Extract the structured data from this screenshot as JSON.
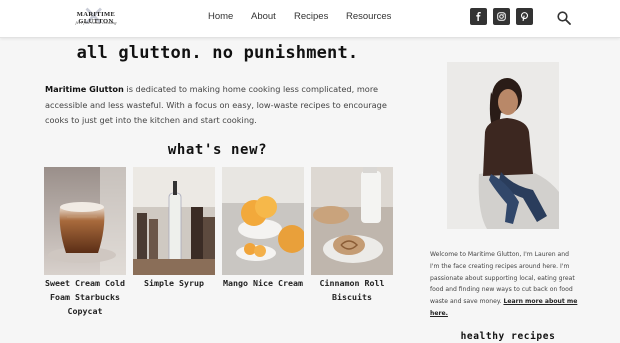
{
  "header": {
    "logo": {
      "name": "MARITIME GLUTTON",
      "tagline": "feel-free home cooking"
    },
    "nav": [
      "Home",
      "About",
      "Recipes",
      "Resources"
    ],
    "social_icons": [
      "facebook-icon",
      "instagram-icon",
      "pinterest-icon"
    ],
    "search_icon": "search-icon"
  },
  "main": {
    "headline": "all glutton. no punishment.",
    "intro": {
      "brand": "Maritime Glutton",
      "text": " is dedicated to making home cooking less complicated, more accessible and less wasteful. With a focus on easy, low-waste recipes to encourage cooks to just get into the kitchen and start cooking."
    },
    "whats_new": "what's new?",
    "posts": [
      {
        "title": "Sweet Cream Cold Foam Starbucks Copycat"
      },
      {
        "title": "Simple Syrup"
      },
      {
        "title": "Mango Nice Cream"
      },
      {
        "title": "Cinnamon Roll Biscuits"
      }
    ]
  },
  "sidebar": {
    "bio": "Welcome to Maritime Glutton, I'm Lauren and I'm the face creating recipes around here. I'm passionate about supporting local, eating great food and finding new ways to cut back on food waste and save money.",
    "learn_more": "Learn more about me here.",
    "healthy_recipes": "healthy recipes"
  },
  "colors": {
    "social_bg": "#333333",
    "page_bg": "#f6f6f6",
    "header_bg": "#ffffff"
  }
}
